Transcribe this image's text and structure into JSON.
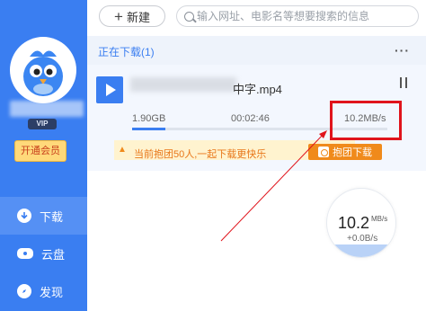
{
  "toolbar": {
    "new_label": "新建",
    "search_placeholder": "输入网址、电影名等想要搜索的信息"
  },
  "sidebar": {
    "vip_badge": "VIP",
    "vip_open_label": "开通会员",
    "items": [
      {
        "label": "下载",
        "icon": "download-icon",
        "active": true
      },
      {
        "label": "云盘",
        "icon": "cloud-icon",
        "active": false
      },
      {
        "label": "发现",
        "icon": "compass-icon",
        "active": false
      }
    ]
  },
  "downloads": {
    "section_title": "正在下载(1)",
    "more": "···",
    "task": {
      "filename_suffix": "中字.mp4",
      "size": "1.90GB",
      "elapsed": "00:02:46",
      "speed": "10.2MB/s",
      "progress_fraction": 0.13,
      "tip_text": "当前抱团50人,一起下载更快乐",
      "group_button": "抱团下载"
    }
  },
  "speed_monitor": {
    "value": "10.2",
    "unit": "MB/s",
    "upload": "+0.0B/s"
  },
  "colors": {
    "brand": "#3a7ef1",
    "highlight": "#e0141c",
    "accent_orange": "#f08a1b"
  }
}
